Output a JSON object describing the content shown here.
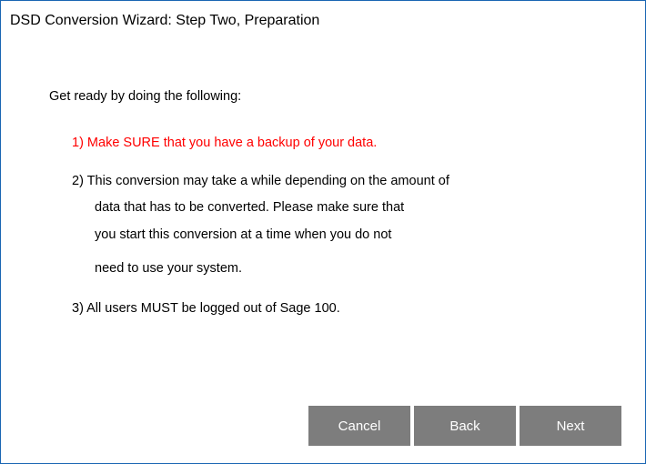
{
  "window": {
    "title": "DSD Conversion Wizard: Step Two, Preparation"
  },
  "content": {
    "intro": "Get ready by doing the following:",
    "item1": "1) Make SURE that you have a backup of your data.",
    "item2_lines": [
      "2) This conversion may take a while depending on the amount of",
      "data that has to be converted.  Please make sure that",
      "you start this conversion at a time when you do not",
      "need to use your system."
    ],
    "item3": "3) All users MUST be logged out of Sage 100."
  },
  "buttons": {
    "cancel": "Cancel",
    "back": "Back",
    "next": "Next"
  },
  "colors": {
    "warning_text": "#ff0000",
    "button_bg": "#7d7d7d",
    "window_border": "#1a66b3"
  }
}
